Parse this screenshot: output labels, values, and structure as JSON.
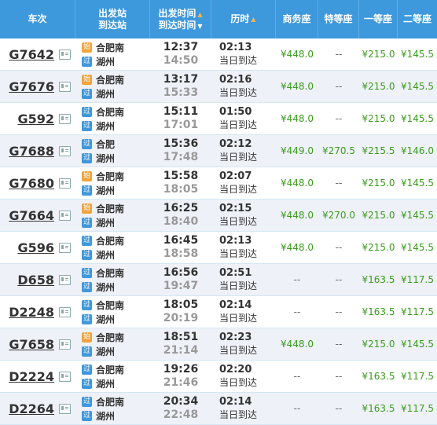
{
  "headers": {
    "train": "车次",
    "stations_top": "出发站",
    "stations_bottom": "到达站",
    "time_top": "出发时间",
    "time_bottom": "到达时间",
    "duration": "历时",
    "business": "商务座",
    "premium": "特等座",
    "first": "一等座",
    "second": "二等座",
    "sort_up_icon": "▲",
    "sort_down_icon": "▼"
  },
  "colors": {
    "header_bg": "#3d98dc",
    "price": "#3a9c1b",
    "start_tag": "#f2a33c",
    "pass_tag": "#3d98dc"
  },
  "rows": [
    {
      "train": "G7642",
      "from_tag": "始",
      "from": "合肥南",
      "to_tag": "过",
      "to": "湖州",
      "dep": "12:37",
      "arr": "14:50",
      "dur": "02:13",
      "same_day": "当日到达",
      "business": "¥448.0",
      "premium": "--",
      "first": "¥215.0",
      "second": "¥145.5"
    },
    {
      "train": "G7676",
      "from_tag": "始",
      "from": "合肥南",
      "to_tag": "过",
      "to": "湖州",
      "dep": "13:17",
      "arr": "15:33",
      "dur": "02:16",
      "same_day": "当日到达",
      "business": "¥448.0",
      "premium": "--",
      "first": "¥215.0",
      "second": "¥145.5"
    },
    {
      "train": "G592",
      "from_tag": "过",
      "from": "合肥南",
      "to_tag": "过",
      "to": "湖州",
      "dep": "15:11",
      "arr": "17:01",
      "dur": "01:50",
      "same_day": "当日到达",
      "business": "¥448.0",
      "premium": "--",
      "first": "¥215.0",
      "second": "¥145.5"
    },
    {
      "train": "G7688",
      "from_tag": "过",
      "from": "合肥",
      "to_tag": "过",
      "to": "湖州",
      "dep": "15:36",
      "arr": "17:48",
      "dur": "02:12",
      "same_day": "当日到达",
      "business": "¥449.0",
      "premium": "¥270.5",
      "first": "¥215.5",
      "second": "¥146.0"
    },
    {
      "train": "G7680",
      "from_tag": "始",
      "from": "合肥南",
      "to_tag": "过",
      "to": "湖州",
      "dep": "15:58",
      "arr": "18:05",
      "dur": "02:07",
      "same_day": "当日到达",
      "business": "¥448.0",
      "premium": "--",
      "first": "¥215.0",
      "second": "¥145.5"
    },
    {
      "train": "G7664",
      "from_tag": "始",
      "from": "合肥南",
      "to_tag": "过",
      "to": "湖州",
      "dep": "16:25",
      "arr": "18:40",
      "dur": "02:15",
      "same_day": "当日到达",
      "business": "¥448.0",
      "premium": "¥270.0",
      "first": "¥215.0",
      "second": "¥145.5"
    },
    {
      "train": "G596",
      "from_tag": "过",
      "from": "合肥南",
      "to_tag": "过",
      "to": "湖州",
      "dep": "16:45",
      "arr": "18:58",
      "dur": "02:13",
      "same_day": "当日到达",
      "business": "¥448.0",
      "premium": "--",
      "first": "¥215.0",
      "second": "¥145.5"
    },
    {
      "train": "D658",
      "from_tag": "过",
      "from": "合肥南",
      "to_tag": "过",
      "to": "湖州",
      "dep": "16:56",
      "arr": "19:47",
      "dur": "02:51",
      "same_day": "当日到达",
      "business": "--",
      "premium": "--",
      "first": "¥163.5",
      "second": "¥117.5"
    },
    {
      "train": "D2248",
      "from_tag": "过",
      "from": "合肥南",
      "to_tag": "过",
      "to": "湖州",
      "dep": "18:05",
      "arr": "20:19",
      "dur": "02:14",
      "same_day": "当日到达",
      "business": "--",
      "premium": "--",
      "first": "¥163.5",
      "second": "¥117.5"
    },
    {
      "train": "G7658",
      "from_tag": "始",
      "from": "合肥南",
      "to_tag": "过",
      "to": "湖州",
      "dep": "18:51",
      "arr": "21:14",
      "dur": "02:23",
      "same_day": "当日到达",
      "business": "¥448.0",
      "premium": "--",
      "first": "¥215.0",
      "second": "¥145.5"
    },
    {
      "train": "D2224",
      "from_tag": "过",
      "from": "合肥南",
      "to_tag": "过",
      "to": "湖州",
      "dep": "19:26",
      "arr": "21:46",
      "dur": "02:20",
      "same_day": "当日到达",
      "business": "--",
      "premium": "--",
      "first": "¥163.5",
      "second": "¥117.5"
    },
    {
      "train": "D2264",
      "from_tag": "过",
      "from": "合肥南",
      "to_tag": "过",
      "to": "湖州",
      "dep": "20:34",
      "arr": "22:48",
      "dur": "02:14",
      "same_day": "当日到达",
      "business": "--",
      "premium": "--",
      "first": "¥163.5",
      "second": "¥117.5"
    }
  ]
}
